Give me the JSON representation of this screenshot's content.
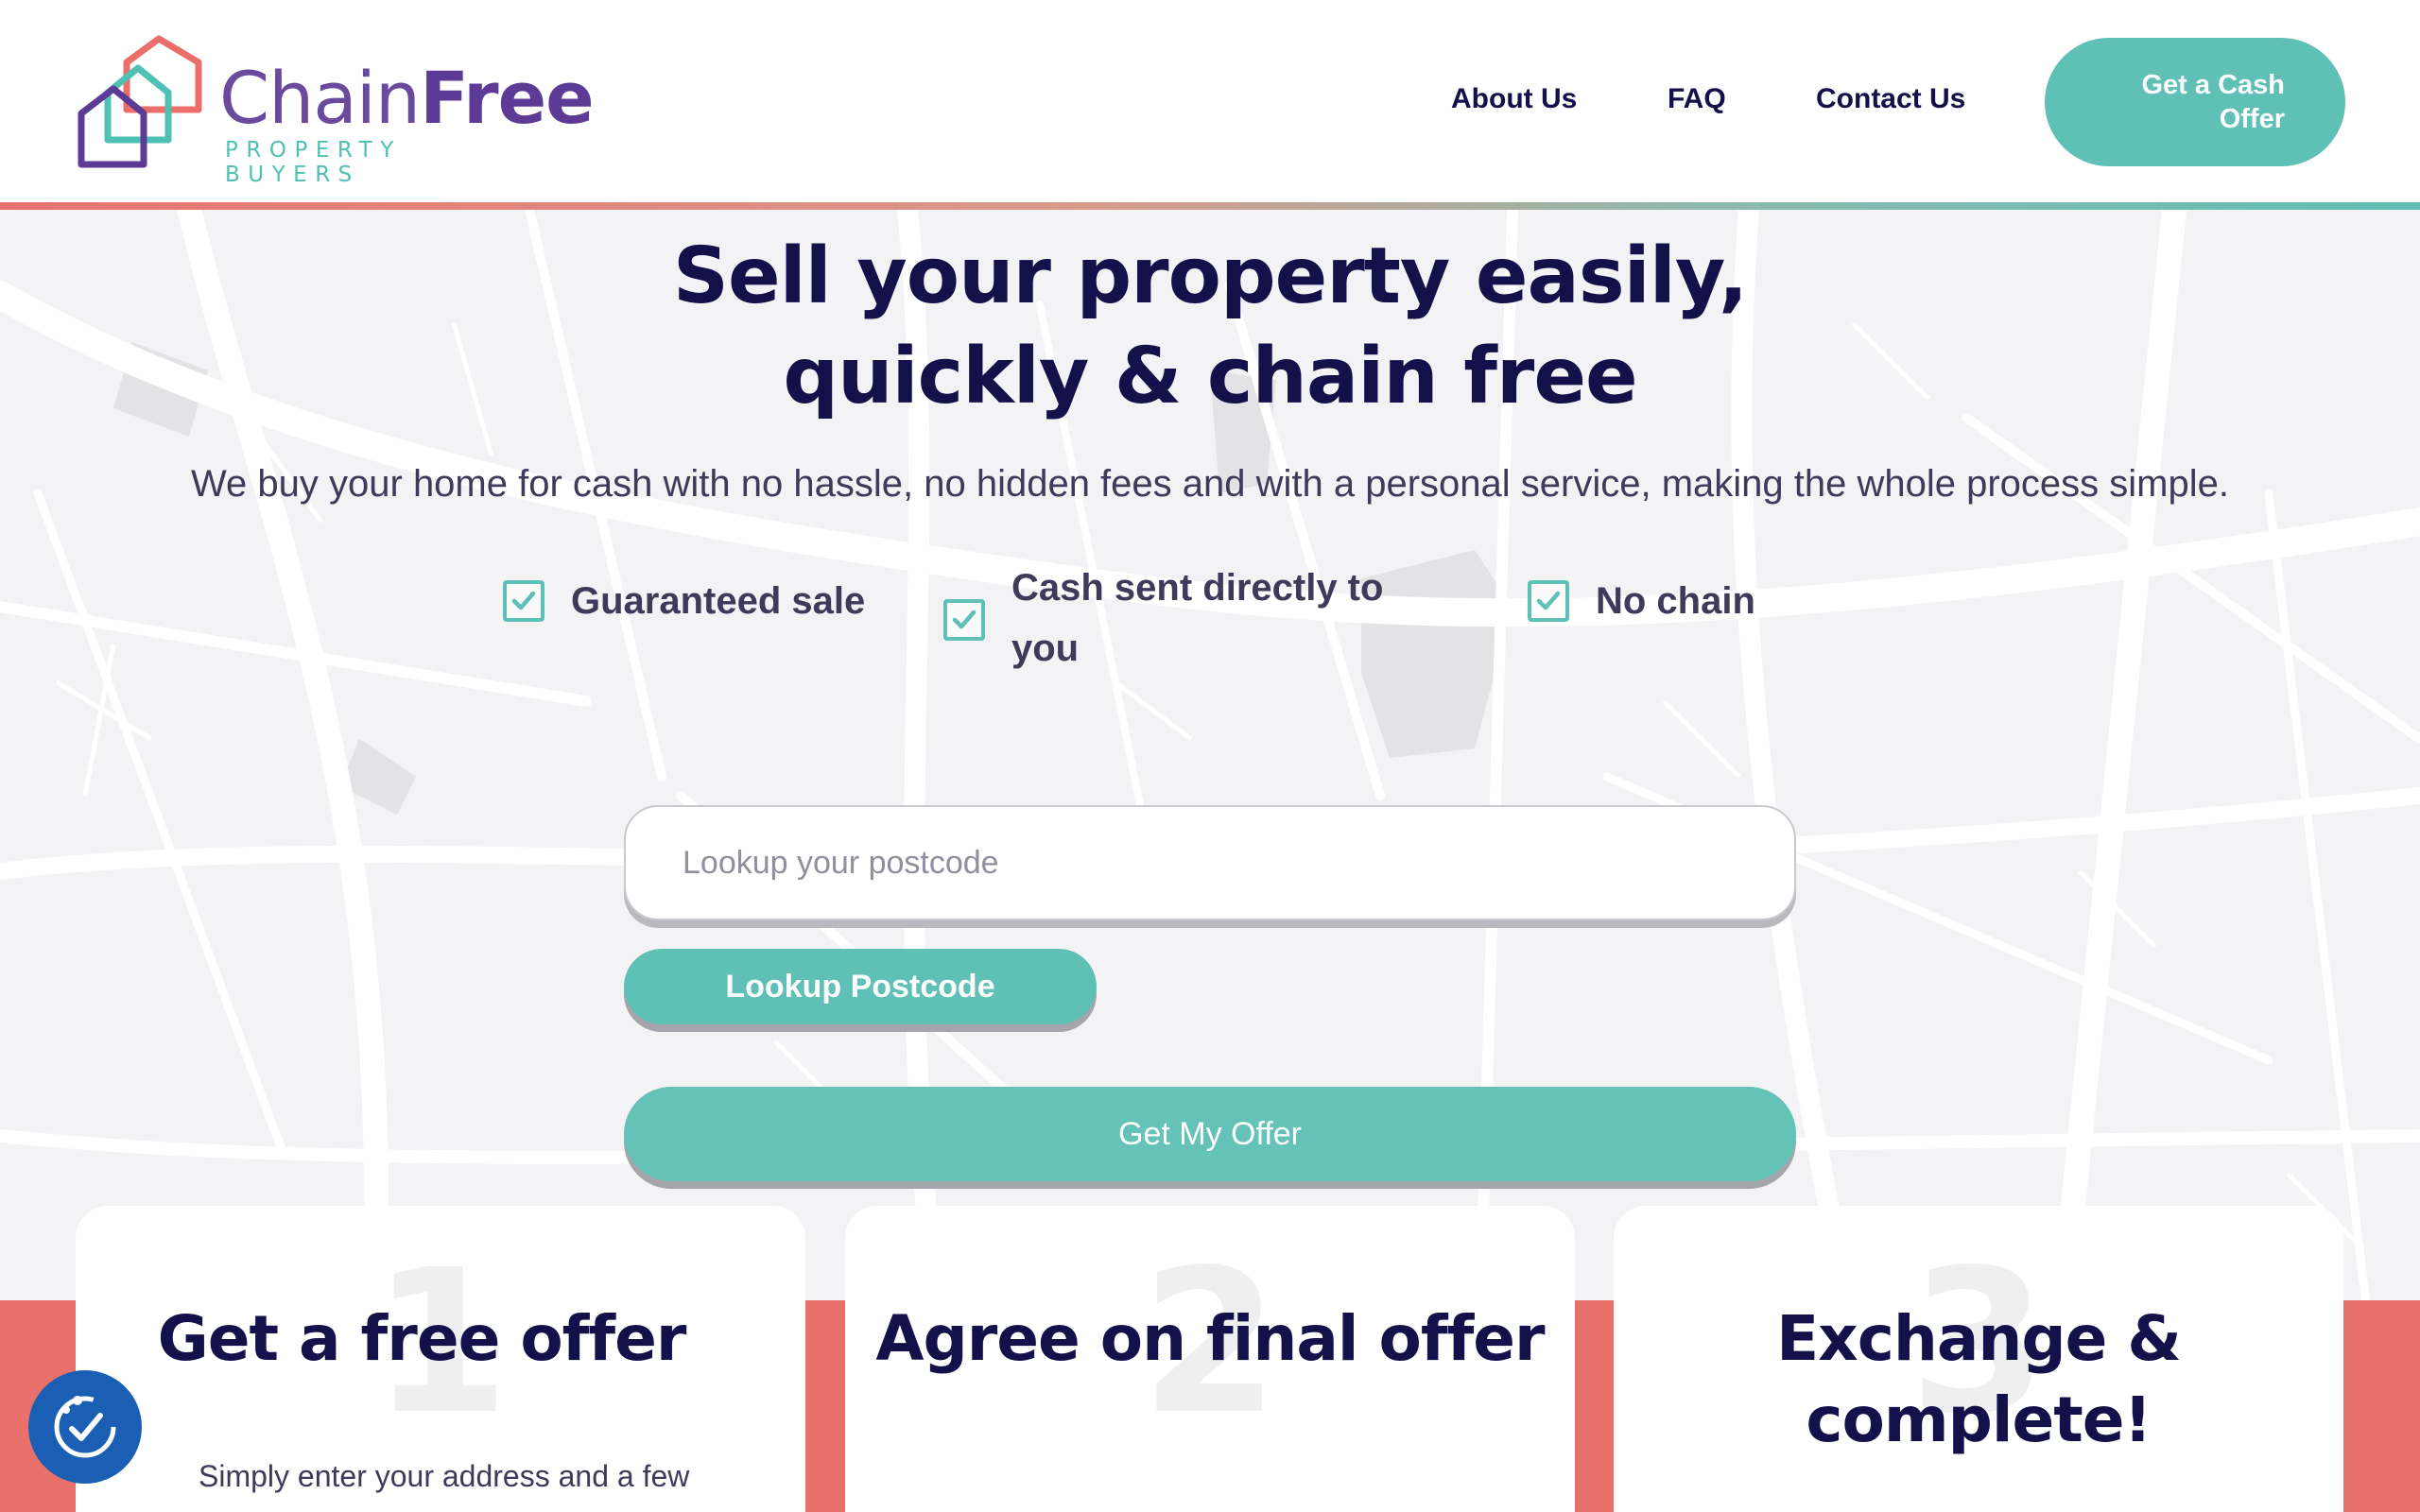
{
  "header": {
    "logo": {
      "word_part1": "Chain",
      "word_part2": "Free",
      "tagline": "PROPERTY BUYERS",
      "icon": "house-logo-icon"
    },
    "nav": {
      "about": "About Us",
      "faq": "FAQ",
      "contact": "Contact Us"
    },
    "cta": "Get a Cash Offer"
  },
  "hero": {
    "title_line1": "Sell your property easily,",
    "title_line2": "quickly & chain free",
    "subtitle": "We buy your home for cash with no hassle, no hidden fees and with a personal service, making the whole process simple.",
    "features": [
      {
        "label": "Guaranteed sale",
        "icon": "checkbox-checked-icon"
      },
      {
        "label": "Cash sent directly to you",
        "icon": "checkbox-checked-icon"
      },
      {
        "label": "No chain",
        "icon": "checkbox-checked-icon"
      }
    ],
    "postcode_placeholder": "Lookup your postcode",
    "lookup_button": "Lookup Postcode",
    "offer_button": "Get My Offer"
  },
  "steps": [
    {
      "number": "1",
      "title": "Get a free offer",
      "description": "Simply enter your address and a few"
    },
    {
      "number": "2",
      "title": "Agree on final offer",
      "description": ""
    },
    {
      "number": "3",
      "title": "Exchange & complete!",
      "description": ""
    }
  ],
  "accessibility": {
    "icon": "accessibility-icon"
  },
  "colors": {
    "navy": "#14104a",
    "teal": "#5fc0b5",
    "salmon": "#e8716c",
    "purple": "#5c3b97",
    "accessibility_blue": "#1a5fb4"
  }
}
